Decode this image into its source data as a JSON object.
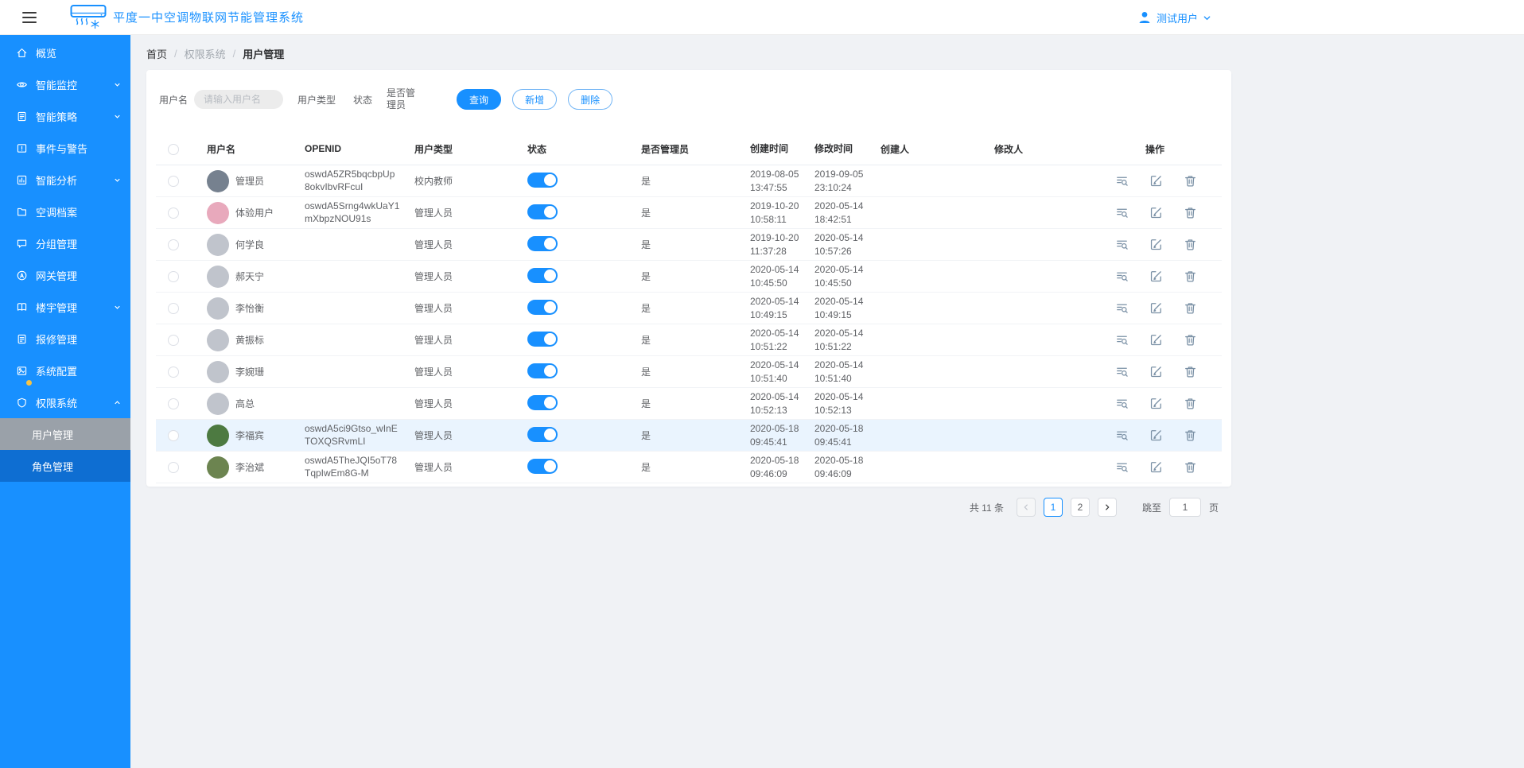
{
  "colors": {
    "primary": "#1890ff",
    "sidebar_bg": "#1890ff",
    "submenu_bg": "#0e6ed2",
    "submenu_active_bg": "#9aa1a9",
    "row_highlight": "#eaf4fe",
    "badge": "#f6c344"
  },
  "header": {
    "title": "平度一中空调物联网节能管理系统",
    "user_name": "测试用户"
  },
  "sidebar": {
    "items": [
      {
        "label": "概览",
        "icon": "home"
      },
      {
        "label": "智能监控",
        "icon": "eye",
        "expandable": true
      },
      {
        "label": "智能策略",
        "icon": "strategy",
        "expandable": true
      },
      {
        "label": "事件与警告",
        "icon": "alert"
      },
      {
        "label": "智能分析",
        "icon": "analysis",
        "expandable": true
      },
      {
        "label": "空调档案",
        "icon": "archive"
      },
      {
        "label": "分组管理",
        "icon": "chat"
      },
      {
        "label": "网关管理",
        "icon": "gateway"
      },
      {
        "label": "楼宇管理",
        "icon": "building",
        "expandable": true
      },
      {
        "label": "报修管理",
        "icon": "repair"
      },
      {
        "label": "系统配置",
        "icon": "config",
        "badge": true
      },
      {
        "label": "权限系统",
        "icon": "shield",
        "expandable": true,
        "expanded": true
      }
    ],
    "subitems": [
      {
        "label": "用户管理",
        "active": true
      },
      {
        "label": "角色管理",
        "active": false
      }
    ]
  },
  "breadcrumb": {
    "items": [
      "首页",
      "权限系统",
      "用户管理"
    ],
    "separator": "/"
  },
  "filters": {
    "username_label": "用户名",
    "username_placeholder": "请输入用户名",
    "usertype_label": "用户类型",
    "status_label": "状态",
    "admin_label": "是否管理员",
    "query_button": "查询",
    "add_button": "新增",
    "delete_button": "删除"
  },
  "table": {
    "columns": [
      "用户名",
      "OPENID",
      "用户类型",
      "状态",
      "是否管理员",
      "创建时间",
      "修改时间",
      "创建人",
      "修改人",
      "操作"
    ],
    "rows": [
      {
        "name": "管理员",
        "openid": "oswdA5ZR5bqcbpUp8okvIbvRFcuI",
        "type": "校内教师",
        "status": true,
        "admin": "是",
        "created": "2019-08-05 13:47:55",
        "modified": "2019-09-05 23:10:24",
        "creator": "",
        "modifier": "",
        "avatar": "#76818f",
        "highlighted": false
      },
      {
        "name": "体验用户",
        "openid": "oswdA5Srng4wkUaY1mXbpzNOU91s",
        "type": "管理人员",
        "status": true,
        "admin": "是",
        "created": "2019-10-20 10:58:11",
        "modified": "2020-05-14 18:42:51",
        "creator": "",
        "modifier": "",
        "avatar": "#e8a9bc",
        "highlighted": false
      },
      {
        "name": "何学良",
        "openid": "",
        "type": "管理人员",
        "status": true,
        "admin": "是",
        "created": "2019-10-20 11:37:28",
        "modified": "2020-05-14 10:57:26",
        "creator": "",
        "modifier": "",
        "avatar": "#c0c4cc",
        "highlighted": false
      },
      {
        "name": "郝天宁",
        "openid": "",
        "type": "管理人员",
        "status": true,
        "admin": "是",
        "created": "2020-05-14 10:45:50",
        "modified": "2020-05-14 10:45:50",
        "creator": "",
        "modifier": "",
        "avatar": "#c0c4cc",
        "highlighted": false
      },
      {
        "name": "李怡衡",
        "openid": "",
        "type": "管理人员",
        "status": true,
        "admin": "是",
        "created": "2020-05-14 10:49:15",
        "modified": "2020-05-14 10:49:15",
        "creator": "",
        "modifier": "",
        "avatar": "#c0c4cc",
        "highlighted": false
      },
      {
        "name": "黄振标",
        "openid": "",
        "type": "管理人员",
        "status": true,
        "admin": "是",
        "created": "2020-05-14 10:51:22",
        "modified": "2020-05-14 10:51:22",
        "creator": "",
        "modifier": "",
        "avatar": "#c0c4cc",
        "highlighted": false
      },
      {
        "name": "李婉珊",
        "openid": "",
        "type": "管理人员",
        "status": true,
        "admin": "是",
        "created": "2020-05-14 10:51:40",
        "modified": "2020-05-14 10:51:40",
        "creator": "",
        "modifier": "",
        "avatar": "#c0c4cc",
        "highlighted": false
      },
      {
        "name": "高总",
        "openid": "",
        "type": "管理人员",
        "status": true,
        "admin": "是",
        "created": "2020-05-14 10:52:13",
        "modified": "2020-05-14 10:52:13",
        "creator": "",
        "modifier": "",
        "avatar": "#c0c4cc",
        "highlighted": false
      },
      {
        "name": "李福宾",
        "openid": "oswdA5ci9Gtso_wInETOXQSRvmLI",
        "type": "管理人员",
        "status": true,
        "admin": "是",
        "created": "2020-05-18 09:45:41",
        "modified": "2020-05-18 09:45:41",
        "creator": "",
        "modifier": "",
        "avatar": "#4d7a41",
        "highlighted": true
      },
      {
        "name": "李治斌",
        "openid": "oswdA5TheJQI5oT78TqpIwEm8G-M",
        "type": "管理人员",
        "status": true,
        "admin": "是",
        "created": "2020-05-18 09:46:09",
        "modified": "2020-05-18 09:46:09",
        "creator": "",
        "modifier": "",
        "avatar": "#6c8450",
        "highlighted": false
      }
    ]
  },
  "pagination": {
    "total_text": "共 11 条",
    "pages": [
      "1",
      "2"
    ],
    "current_page": "1",
    "jump_label": "跳至",
    "jump_value": "1",
    "page_unit": "页"
  }
}
